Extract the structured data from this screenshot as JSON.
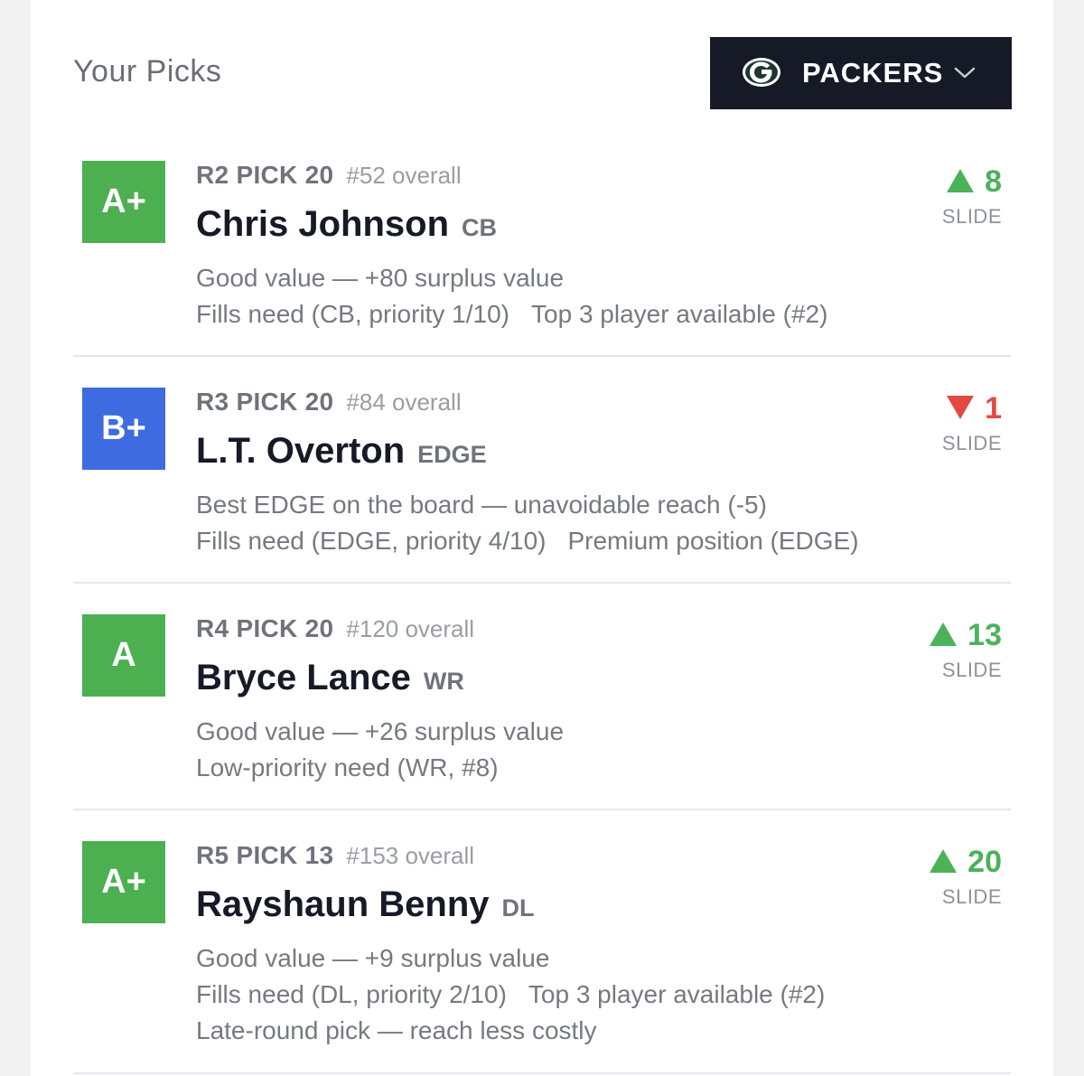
{
  "header": {
    "title": "Your Picks",
    "team_select": {
      "label": "PACKERS",
      "logo_icon": "packers-g-logo",
      "chevron_icon": "chevron-down-icon"
    }
  },
  "colors": {
    "grade_green": "#4caf50",
    "grade_blue": "#3f6be0",
    "slide_up": "#4bb25a",
    "slide_down": "#e04a42",
    "team_bg": "#151a26"
  },
  "picks": [
    {
      "grade": "A+",
      "grade_color": "#4caf50",
      "pick_label": "R2 PICK 20",
      "overall": "#52 overall",
      "name": "Chris Johnson",
      "position": "CB",
      "notes": [
        [
          "Good value — +80 surplus value"
        ],
        [
          "Fills need (CB, priority 1/10)",
          "Top 3 player available (#2)"
        ]
      ],
      "slide_direction": "up",
      "slide_value": "8",
      "slide_label": "SLIDE"
    },
    {
      "grade": "B+",
      "grade_color": "#3f6be0",
      "pick_label": "R3 PICK 20",
      "overall": "#84 overall",
      "name": "L.T. Overton",
      "position": "EDGE",
      "notes": [
        [
          "Best EDGE on the board — unavoidable reach (-5)"
        ],
        [
          "Fills need (EDGE, priority 4/10)",
          "Premium position (EDGE)"
        ]
      ],
      "slide_direction": "down",
      "slide_value": "1",
      "slide_label": "SLIDE"
    },
    {
      "grade": "A",
      "grade_color": "#4caf50",
      "pick_label": "R4 PICK 20",
      "overall": "#120 overall",
      "name": "Bryce Lance",
      "position": "WR",
      "notes": [
        [
          "Good value — +26 surplus value"
        ],
        [
          "Low-priority need (WR, #8)"
        ]
      ],
      "slide_direction": "up",
      "slide_value": "13",
      "slide_label": "SLIDE"
    },
    {
      "grade": "A+",
      "grade_color": "#4caf50",
      "pick_label": "R5 PICK 13",
      "overall": "#153 overall",
      "name": "Rayshaun Benny",
      "position": "DL",
      "notes": [
        [
          "Good value — +9 surplus value"
        ],
        [
          "Fills need (DL, priority 2/10)",
          "Top 3 player available (#2)"
        ],
        [
          "Late-round pick — reach less costly"
        ]
      ],
      "slide_direction": "up",
      "slide_value": "20",
      "slide_label": "SLIDE"
    }
  ]
}
